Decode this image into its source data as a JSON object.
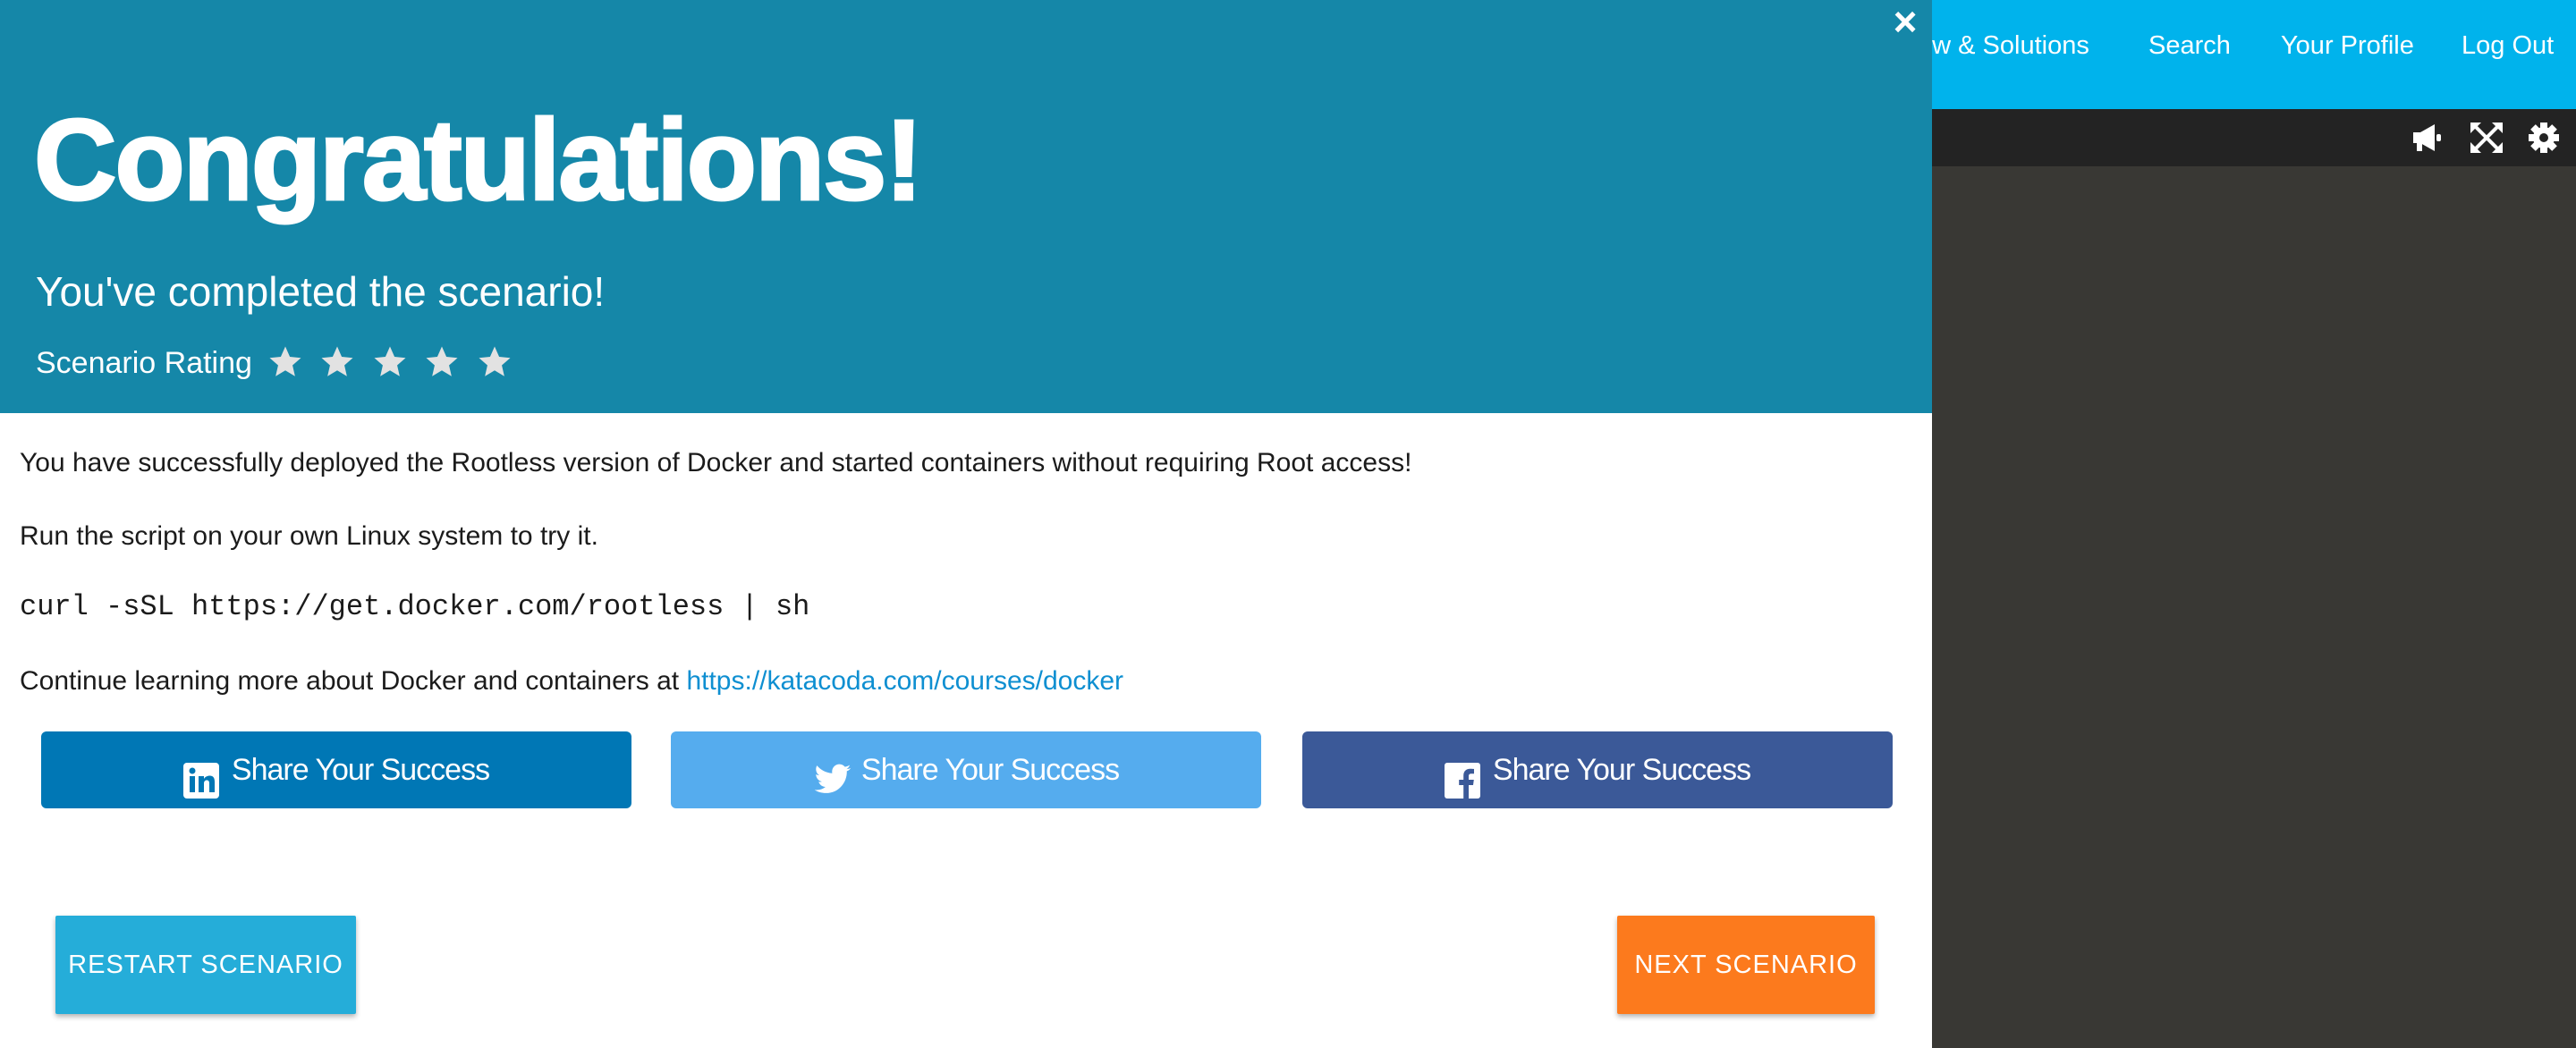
{
  "topnav": {
    "items": [
      "ew & Solutions",
      "Search",
      "Your Profile",
      "Log Out"
    ]
  },
  "toolbar": {
    "icons": [
      "megaphone-icon",
      "expand-icon",
      "gear-icon"
    ]
  },
  "modal": {
    "close_label": "×",
    "title": "Congratulations!",
    "subtitle": "You've completed the scenario!",
    "rating_label": "Scenario Rating",
    "rating_max": 5,
    "paragraphs": {
      "p1": "You have successfully deployed the Rootless version of Docker and started containers without requiring Root access!",
      "p2": "Run the script on your own Linux system to try it.",
      "code": "curl -sSL https://get.docker.com/rootless | sh",
      "p4_prefix": "Continue learning more about Docker and containers at ",
      "p4_link": "https://katacoda.com/courses/docker"
    },
    "share": {
      "linkedin": "Share Your Success",
      "twitter": "Share Your Success",
      "facebook": "Share Your Success"
    },
    "buttons": {
      "restart": "RESTART SCENARIO",
      "next": "NEXT SCENARIO"
    }
  },
  "colors": {
    "header_bg": "#1587a8",
    "nav_bg": "#00b3ec",
    "linkedin": "#0077b5",
    "twitter": "#55acee",
    "facebook": "#3b5998",
    "restart": "#25add9",
    "next": "#fc7a1d"
  }
}
